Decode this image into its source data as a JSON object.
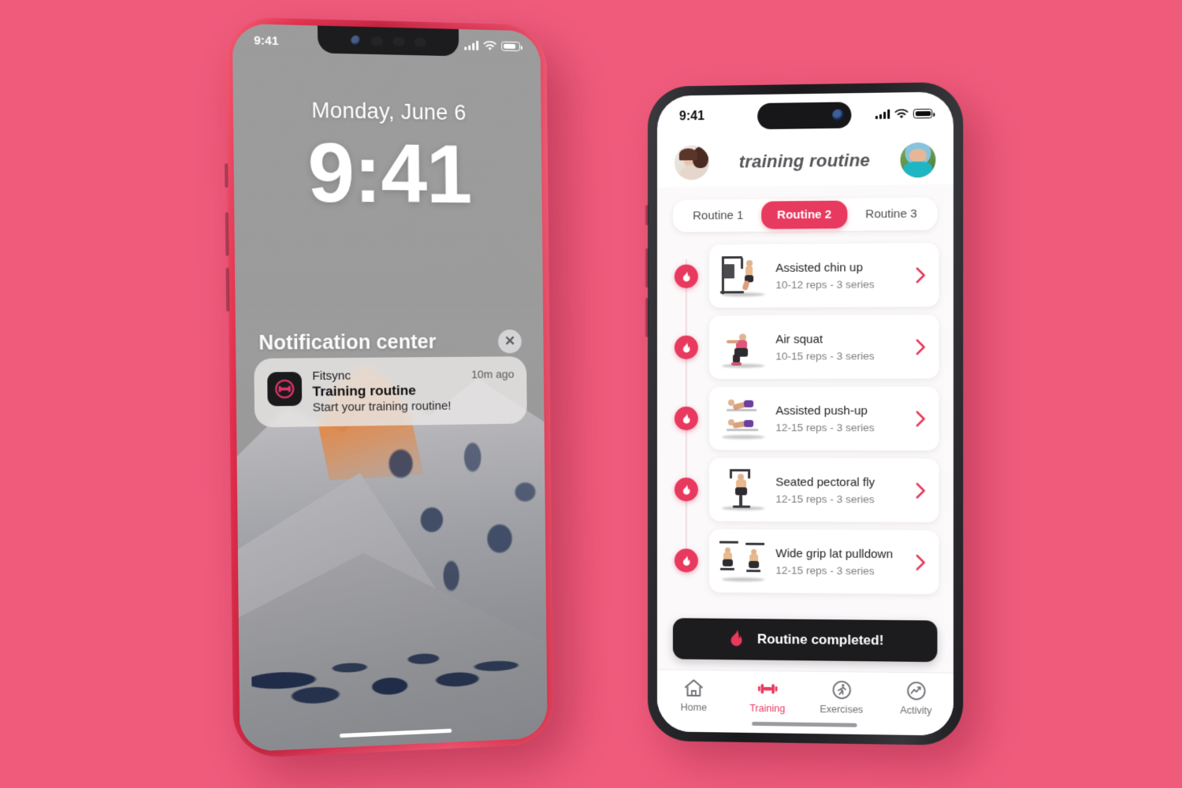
{
  "background_color": "#f05b7c",
  "accent_color": "#e8395e",
  "left_phone": {
    "frame_color": "#d42b48",
    "status_bar": {
      "time": "9:41",
      "signal_icon": "cellular-bars-icon",
      "wifi_icon": "wifi-icon",
      "battery_icon": "battery-icon"
    },
    "lock_screen": {
      "date": "Monday, June 6",
      "time": "9:41",
      "wallpaper": "snow-mountain-wallpaper"
    },
    "notification_center": {
      "title": "Notification center",
      "close_icon": "close-icon",
      "notification": {
        "app_icon": "fitsync-app-icon",
        "app_name": "Fitsync",
        "time": "10m ago",
        "title": "Training routine",
        "body": "Start your training routine!"
      }
    },
    "home_indicator": "home-indicator"
  },
  "right_phone": {
    "frame_color": "#232326",
    "status_bar": {
      "time": "9:41",
      "signal_icon": "cellular-bars-icon",
      "wifi_icon": "wifi-icon",
      "battery_icon": "battery-icon",
      "dynamic_island": "dynamic-island"
    },
    "header": {
      "left_avatar": "user-avatar-female",
      "title": "training routine",
      "right_avatar": "user-avatar-male"
    },
    "routine_tabs": [
      {
        "label": "Routine 1",
        "active": false
      },
      {
        "label": "Routine 2",
        "active": true
      },
      {
        "label": "Routine 3",
        "active": false
      }
    ],
    "exercises": [
      {
        "marker_icon": "flame-icon",
        "thumbnail": "assisted-chin-up-thumbnail",
        "name": "Assisted chin up",
        "detail": "10-12 reps - 3 series",
        "chevron_icon": "chevron-right-icon"
      },
      {
        "marker_icon": "flame-icon",
        "thumbnail": "air-squat-thumbnail",
        "name": "Air squat",
        "detail": "10-15 reps - 3 series",
        "chevron_icon": "chevron-right-icon"
      },
      {
        "marker_icon": "flame-icon",
        "thumbnail": "assisted-push-up-thumbnail",
        "name": "Assisted push-up",
        "detail": "12-15 reps - 3 series",
        "chevron_icon": "chevron-right-icon"
      },
      {
        "marker_icon": "flame-icon",
        "thumbnail": "seated-pectoral-fly-thumbnail",
        "name": "Seated pectoral fly",
        "detail": "12-15 reps - 3 series",
        "chevron_icon": "chevron-right-icon"
      },
      {
        "marker_icon": "flame-icon",
        "thumbnail": "wide-grip-lat-pulldown-thumbnail",
        "name": "Wide grip lat pulldown",
        "detail": "12-15 reps - 3 series",
        "chevron_icon": "chevron-right-icon"
      }
    ],
    "cta": {
      "icon": "flame-icon",
      "label": "Routine completed!"
    },
    "tabbar": [
      {
        "label": "Home",
        "icon": "home-icon",
        "active": false
      },
      {
        "label": "Training",
        "icon": "dumbbell-icon",
        "active": true
      },
      {
        "label": "Exercises",
        "icon": "runner-icon",
        "active": false
      },
      {
        "label": "Activity",
        "icon": "activity-chart-icon",
        "active": false
      }
    ],
    "home_indicator": "home-indicator"
  }
}
